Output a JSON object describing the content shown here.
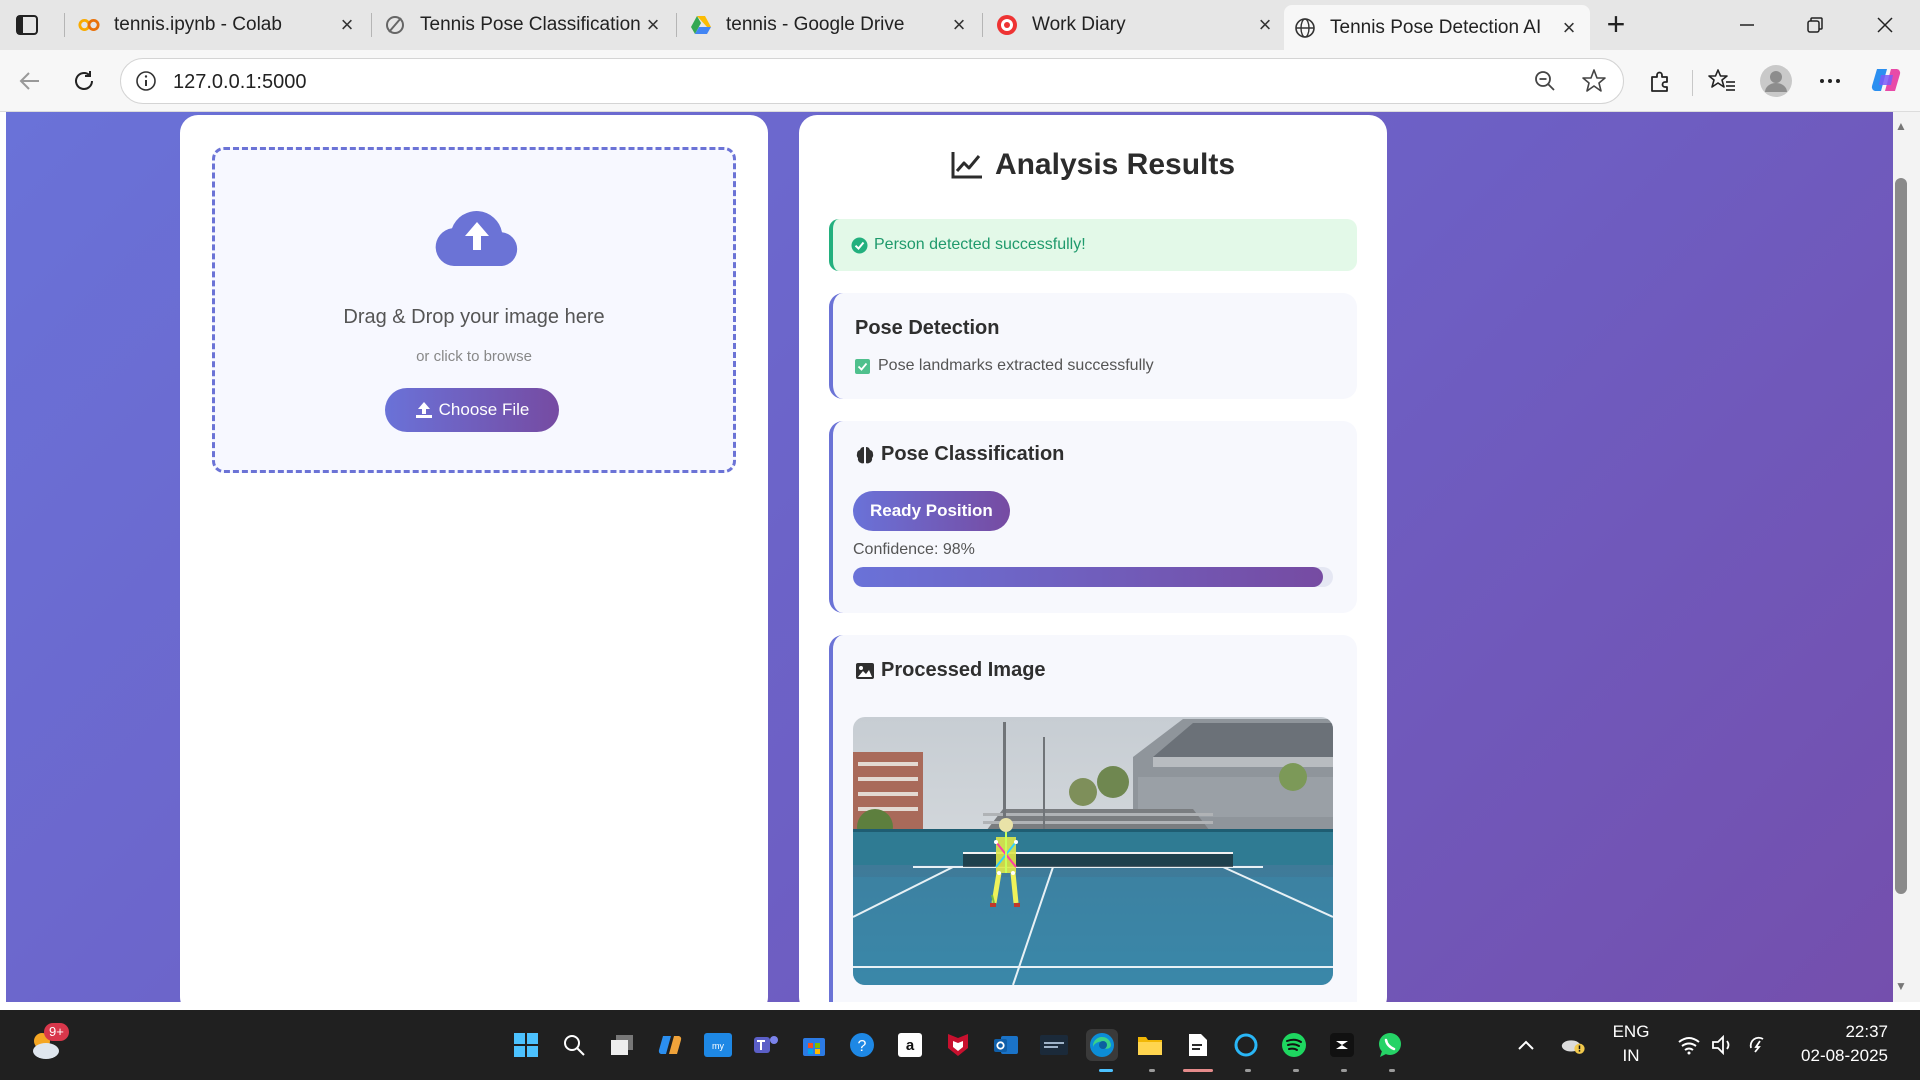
{
  "browser": {
    "tabs": [
      {
        "title": "tennis.ipynb - Colab",
        "icon": "colab-icon"
      },
      {
        "title": "Tennis Pose Classification F",
        "icon": "refresh-slash-icon"
      },
      {
        "title": "tennis - Google Drive",
        "icon": "google-drive-icon"
      },
      {
        "title": "Work Diary",
        "icon": "work-diary-icon"
      },
      {
        "title": "Tennis Pose Detection AI",
        "icon": "globe-icon"
      }
    ],
    "active_tab_index": 4,
    "url": "127.0.0.1:5000"
  },
  "upload": {
    "drop_title": "Drag & Drop your image here",
    "drop_sub": "or click to browse",
    "button_label": "Choose File"
  },
  "results": {
    "title": "Analysis Results",
    "alert": "Person detected successfully!",
    "pose_detection": {
      "title": "Pose Detection",
      "status": "Pose landmarks extracted successfully"
    },
    "pose_classification": {
      "title": "Pose Classification",
      "label": "Ready Position",
      "confidence_text": "Confidence: 98%",
      "confidence": 0.98
    },
    "processed_image": {
      "title": "Processed Image"
    }
  },
  "taskbar": {
    "weather_badge": "9+",
    "language": "ENG",
    "region": "IN",
    "time": "22:37",
    "date": "02-08-2025"
  },
  "colors": {
    "accent_start": "#6a72d8",
    "accent_end": "#764ba2",
    "success": "#23b07e",
    "success_bg": "#e3f9e8"
  }
}
